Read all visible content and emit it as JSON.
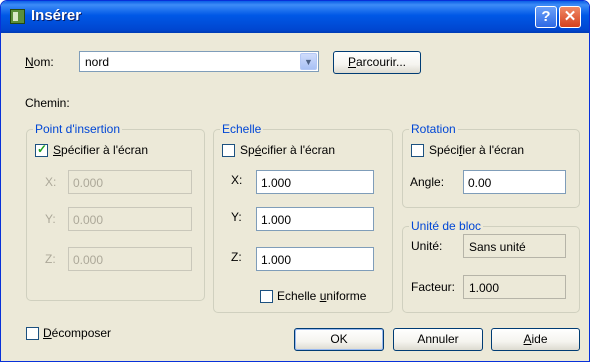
{
  "window": {
    "title": "Insérer",
    "help_glyph": "?",
    "close_glyph": "✕"
  },
  "name_row": {
    "label": "Nom:",
    "value": "nord",
    "browse_label": "Parcourir..."
  },
  "path": {
    "label": "Chemin:"
  },
  "insertion_point": {
    "title": "Point d'insertion",
    "specify_on_screen": {
      "label": "Spécifier à l'écran",
      "checked": true
    },
    "x": {
      "label": "X:",
      "value": "0.000"
    },
    "y": {
      "label": "Y:",
      "value": "0.000"
    },
    "z": {
      "label": "Z:",
      "value": "0.000"
    }
  },
  "scale": {
    "title": "Echelle",
    "specify_on_screen": {
      "label": "Spécifier à l'écran",
      "checked": false
    },
    "x": {
      "label": "X:",
      "value": "1.000"
    },
    "y": {
      "label": "Y:",
      "value": "1.000"
    },
    "z": {
      "label": "Z:",
      "value": "1.000"
    },
    "uniform": {
      "label": "Echelle uniforme",
      "checked": false
    }
  },
  "rotation": {
    "title": "Rotation",
    "specify_on_screen": {
      "label": "Spécifier à l'écran",
      "checked": false
    },
    "angle": {
      "label": "Angle:",
      "value": "0.00"
    }
  },
  "block_unit": {
    "title": "Unité de bloc",
    "unit": {
      "label": "Unité:",
      "value": "Sans unité"
    },
    "factor": {
      "label": "Facteur:",
      "value": "1.000"
    }
  },
  "explode": {
    "label": "Décomposer",
    "checked": false
  },
  "buttons": {
    "ok": "OK",
    "cancel": "Annuler",
    "help": "Aide"
  }
}
